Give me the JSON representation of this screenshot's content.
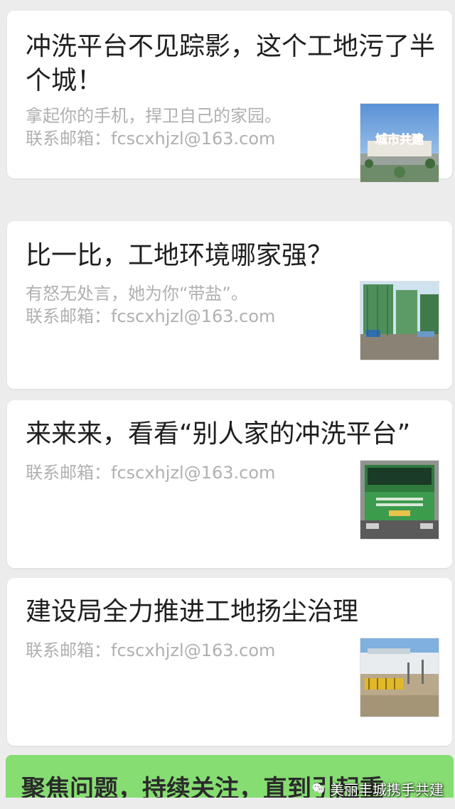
{
  "articles": [
    {
      "title": "冲洗平台不见踪影，这个工地污了半个城！",
      "desc": "拿起你的手机，捍卫自己的家园。\n联系邮箱：fcscxhjzl@163.com",
      "thumb_text": "城市共建"
    },
    {
      "title": "比一比，工地环境哪家强？",
      "desc": "有怒无处言，她为你“带盐”。\n联系邮箱：fcscxhjzl@163.com"
    },
    {
      "title": "来来来，看看“别人家的冲洗平台”",
      "desc": "联系邮箱：fcscxhjzl@163.com"
    },
    {
      "title": "建设局全力推进工地扬尘治理",
      "desc": "联系邮箱：fcscxhjzl@163.com"
    }
  ],
  "banner": {
    "text": "聚焦问题，持续关注，直到引起重"
  },
  "watermark": {
    "text": "美丽丰城携手共建",
    "icon": "wechat-icon"
  },
  "colors": {
    "background": "#ececec",
    "card": "#ffffff",
    "title": "#1f1f1f",
    "desc": "#b0b0b0",
    "banner": "#86dd72"
  }
}
